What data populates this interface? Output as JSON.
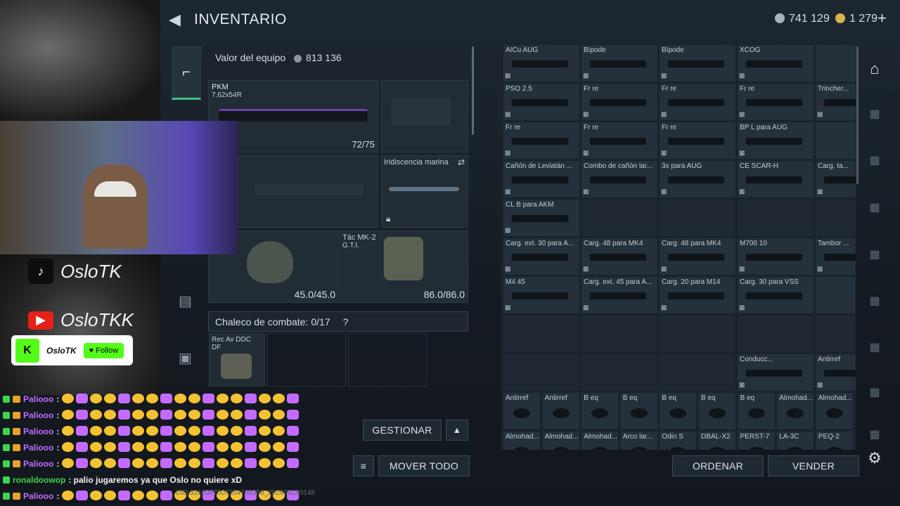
{
  "header": {
    "title": "INVENTARIO",
    "currency1": "741 129",
    "currency2": "1 279"
  },
  "loadout": {
    "equip_label": "Valor del equipo",
    "equip_value": "813 136",
    "primary_name": "PKM",
    "primary_caliber": "7,62x54R",
    "primary_ammo": "72/75",
    "skin_label": "Iridiscencia marina",
    "helmet_dur": "45.0/45.0",
    "armor_name": "Tác MK-2",
    "armor_sub": "G.T.I.",
    "armor_dur": "86.0/86.0",
    "vest_label": "Chaleco de combate:",
    "vest_count": "0/17",
    "vest_help": "?",
    "vest_item": "Rec Av DDC DF"
  },
  "inventory": {
    "rows": [
      [
        "AICu AUG",
        "Bípode",
        "Bípode",
        "XCOG",
        ""
      ],
      [
        "PSO 2.5",
        "Fr re",
        "Fr re",
        "Fr re",
        "Trincher..."
      ],
      [
        "Fr re",
        "Fr re",
        "Fr re",
        "BP L para AUG",
        ""
      ],
      [
        "Cañón de Leviatán ...",
        "Combo de cañón lar...",
        "3x para AUG",
        "CE SCAR-H",
        "Carg. ta..."
      ],
      [
        "CL B para AKM",
        "",
        "",
        "",
        ""
      ],
      [
        "Carg. ext. 30 para A...",
        "Carg. 48 para MK4",
        "Carg. 48 para MK4",
        "M700 10",
        "Tambor ..."
      ],
      [
        "M4 45",
        "Carg. ext. 45 para A...",
        "Carg. 20 para M14",
        "Carg. 30 para VSS",
        ""
      ],
      [
        "",
        "",
        "",
        "",
        ""
      ],
      [
        "",
        "",
        "",
        "Conducc...",
        "Antirref"
      ]
    ],
    "small_row1": [
      "Antirref",
      "Antirref",
      "B eq",
      "B eq",
      "B eq",
      "B eq",
      "B eq",
      "Almohad...",
      "Almohad..."
    ],
    "small_row2": [
      "Almohad...",
      "Almohad...",
      "Almohad...",
      "Arco lar...",
      "Odin S",
      "DBAL-X2",
      "PERST-7",
      "LA-3C",
      "PEQ-2"
    ]
  },
  "buttons": {
    "gestionar": "GESTIONAR",
    "mover": "MOVER TODO",
    "ordenar": "ORDENAR",
    "vender": "VENDER"
  },
  "overlay": {
    "tiktok": "OsloTK",
    "youtube": "OsloTKK",
    "kick_name": "OsloTK",
    "kick_follow": "Follow",
    "chat": [
      {
        "user": "Paliooo",
        "msg": ":"
      },
      {
        "user": "Paliooo",
        "msg": ":"
      },
      {
        "user": "Paliooo",
        "msg": ":"
      },
      {
        "user": "Paliooo",
        "msg": ":"
      },
      {
        "user": "Paliooo",
        "msg": ":"
      },
      {
        "user": "ronaldoowop",
        "msg": ": palio jugaremos ya que Oslo no quiere xD"
      },
      {
        "user": "Paliooo",
        "msg": ":"
      }
    ],
    "footer_id": "UID:3310367007354708358_202608180148"
  },
  "colors": {
    "accent": "#3fbf86",
    "chat_user": "#c46bff",
    "chat_user2": "#3fd24e"
  }
}
